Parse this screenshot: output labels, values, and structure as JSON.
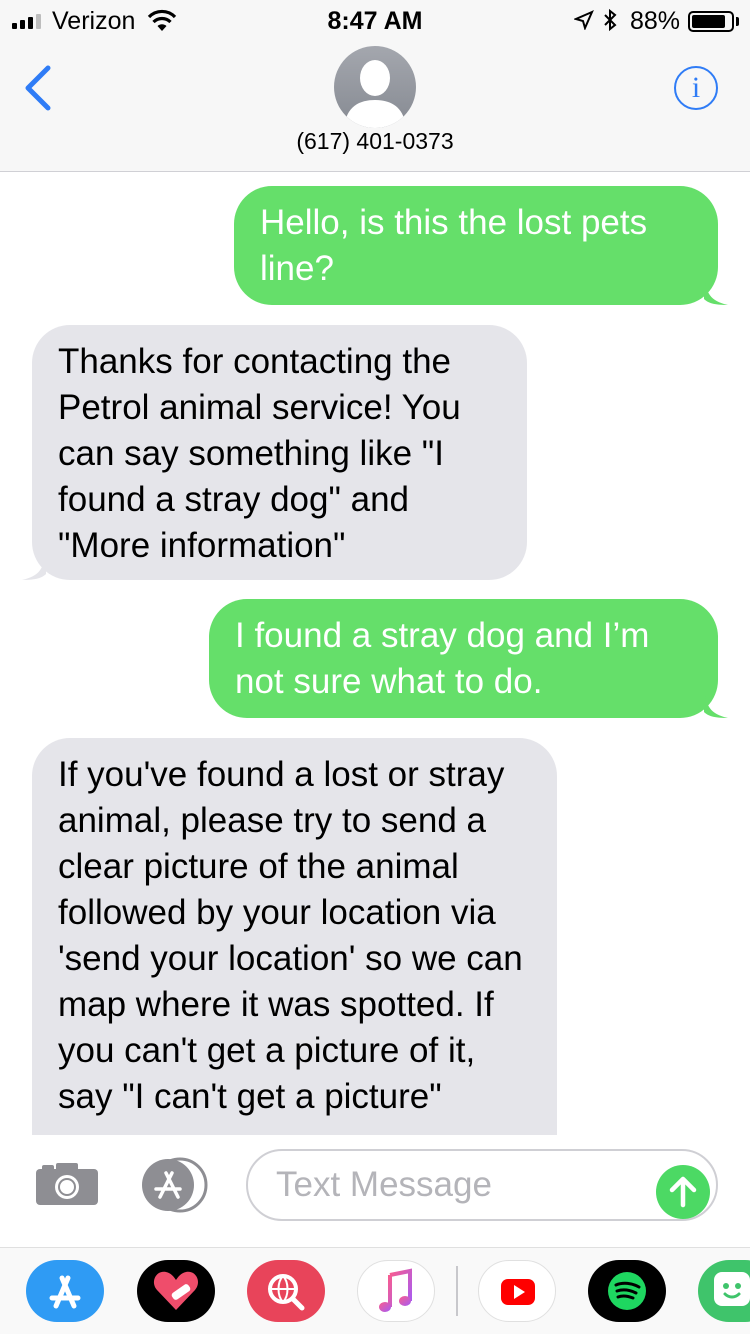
{
  "status_bar": {
    "carrier": "Verizon",
    "time": "8:47 AM",
    "battery_percent": "88%",
    "battery_level": 0.88,
    "signal_bars": 3
  },
  "header": {
    "contact_number": "(617) 401-0373"
  },
  "messages": [
    {
      "direction": "outgoing",
      "text": "Hello, is this the lost pets line?"
    },
    {
      "direction": "incoming",
      "text": "Thanks for contacting the Petrol animal service! You can say something like \"I found a stray dog\" and \"More information\""
    },
    {
      "direction": "outgoing",
      "text": "I found a stray dog and I’m not sure what to do."
    },
    {
      "direction": "incoming",
      "text": "If you've found a lost or stray animal, please try to send a clear picture of the animal followed by your location via  'send your location' so we can map where it was spotted. If you can't get a picture of it, say \"I can't get a picture\""
    }
  ],
  "input": {
    "placeholder": "Text Message"
  },
  "colors": {
    "outgoing_bubble": "#65df6a",
    "incoming_bubble": "#e5e5ea",
    "accent_blue": "#2f7cf6",
    "send_green": "#4cd964"
  },
  "drawer_apps": [
    "app-store-icon",
    "heart-sticker-icon",
    "web-search-icon",
    "music-icon",
    "youtube-icon",
    "spotify-icon",
    "bitmoji-icon"
  ]
}
